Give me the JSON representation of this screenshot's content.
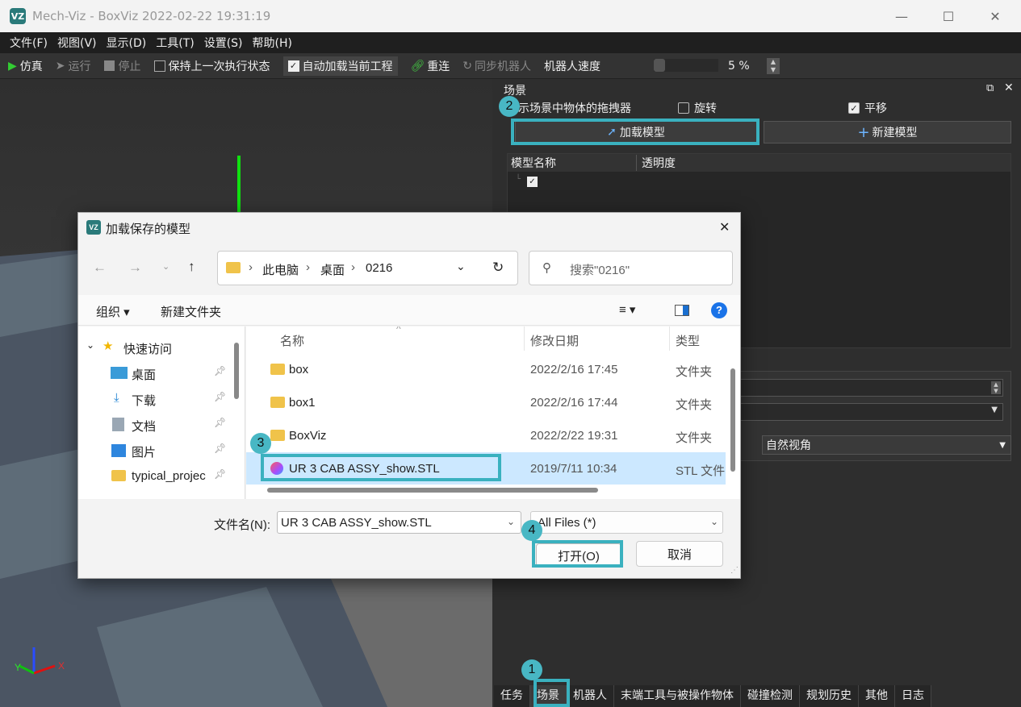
{
  "window": {
    "title": "Mech-Viz - BoxViz 2022-02-22 19:31:19",
    "logo": "VZ",
    "min": "—",
    "max": "☐",
    "close": "✕"
  },
  "menu": [
    "文件(F)",
    "视图(V)",
    "显示(D)",
    "工具(T)",
    "设置(S)",
    "帮助(H)"
  ],
  "toolbar": {
    "simulate": "仿真",
    "run": "运行",
    "stop": "停止",
    "keep_state": "保持上一次执行状态",
    "auto_load": "自动加载当前工程",
    "reconnect": "重连",
    "sync_robot": "同步机器人",
    "robot_speed": "机器人速度",
    "speed_value": "5 %"
  },
  "scene": {
    "title": "场景",
    "show_draggers": "示场景中物体的拖拽器",
    "rotate": "旋转",
    "translate": "平移",
    "load_model": "加载模型",
    "new_model": "新建模型",
    "col_name": "模型名称",
    "col_opacity": "透明度",
    "view_select": "自然视角"
  },
  "bottom_tabs": [
    "任务",
    "场景",
    "机器人",
    "末端工具与被操作物体",
    "碰撞检测",
    "规划历史",
    "其他",
    "日志"
  ],
  "steps": [
    "1",
    "2",
    "3",
    "4"
  ],
  "dialog": {
    "title": "加载保存的模型",
    "breadcrumb": [
      "此电脑",
      "桌面",
      "0216"
    ],
    "search_placeholder": "搜索\"0216\"",
    "organize": "组织 ▾",
    "new_folder": "新建文件夹",
    "nav": {
      "quick": "快速访问",
      "items": [
        "桌面",
        "下载",
        "文档",
        "图片",
        "typical_projec"
      ]
    },
    "columns": {
      "name": "名称",
      "date": "修改日期",
      "type": "类型"
    },
    "files": [
      {
        "name": "box",
        "date": "2022/2/16 17:45",
        "type": "文件夹"
      },
      {
        "name": "box1",
        "date": "2022/2/16 17:44",
        "type": "文件夹"
      },
      {
        "name": "BoxViz",
        "date": "2022/2/22 19:31",
        "type": "文件夹"
      },
      {
        "name": "UR 3 CAB ASSY_show.STL",
        "date": "2019/7/11 10:34",
        "type": "STL 文件"
      }
    ],
    "filename_label": "文件名(N):",
    "filename_value": "UR 3 CAB ASSY_show.STL",
    "filter": "All Files (*)",
    "open": "打开(O)",
    "cancel": "取消"
  }
}
